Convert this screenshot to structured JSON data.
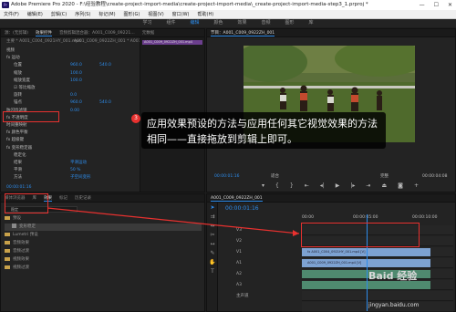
{
  "window": {
    "title": "Adobe Premiere Pro 2020 - F:\\经验教程\\create-project-import-media\\create-project-import-media\\_create-project-import-media-step3_1.prproj *",
    "controls": [
      "—",
      "☐",
      "✕"
    ]
  },
  "menu": [
    "文件(F)",
    "编辑(E)",
    "剪辑(C)",
    "序列(S)",
    "标记(M)",
    "图形(G)",
    "视图(V)",
    "窗口(W)",
    "帮助(H)"
  ],
  "workspaces": {
    "items": [
      "学习",
      "组件",
      "编辑",
      "颜色",
      "效果",
      "音频",
      "图形",
      "库"
    ],
    "active_index": 2
  },
  "effect_controls": {
    "tabs": [
      "源：(无剪辑)",
      "效果控件",
      "音频剪辑混合器：A001_C009_09221…",
      "元数据"
    ],
    "active_tab_index": 1,
    "source_label": "主要 * A001_C004_0921HY_001.mp4",
    "sequence_label": "A001_C009_0922ZH_001 * A001_C…",
    "clip_name": "A001_C009_0922ZH_001.mp4",
    "rows": [
      {
        "label": "视频",
        "value": "",
        "value2": ""
      },
      {
        "label": "fx 运动",
        "value": "",
        "value2": ""
      },
      {
        "label": "位置",
        "value": "960.0",
        "value2": "540.0"
      },
      {
        "label": "缩放",
        "value": "100.0",
        "value2": ""
      },
      {
        "label": "缩放宽度",
        "value": "100.0",
        "value2": ""
      },
      {
        "label": "☑ 等比缩放",
        "value": "",
        "value2": ""
      },
      {
        "label": "旋转",
        "value": "0.0",
        "value2": ""
      },
      {
        "label": "锚点",
        "value": "960.0",
        "value2": "540.0"
      },
      {
        "label": "防闪烁滤镜",
        "value": "0.00",
        "value2": ""
      },
      {
        "label": "fx 不透明度",
        "value": "",
        "value2": ""
      },
      {
        "label": "时间重映射",
        "value": "",
        "value2": ""
      },
      {
        "label": "fx 颜色平衡",
        "value": "",
        "value2": ""
      },
      {
        "label": "fx 超级键",
        "value": "",
        "value2": ""
      },
      {
        "label": "fx 变形稳定器",
        "value": "",
        "value2": ""
      },
      {
        "label": "稳定化",
        "value": "",
        "value2": ""
      },
      {
        "label": "结果",
        "value": "平滑运动",
        "value2": ""
      },
      {
        "label": "平滑",
        "value": "50 %",
        "value2": ""
      },
      {
        "label": "方法",
        "value": "子空间变形",
        "value2": ""
      }
    ],
    "timecode": "00:00:01:16"
  },
  "program_monitor": {
    "title": "节目：A001_C009_0922ZH_001",
    "timecode": "00:00:01:16",
    "fit": "适合",
    "quality": "完整",
    "duration": "00:00:04:08"
  },
  "project_panel": {
    "tabs": [
      "媒体浏览器",
      "库",
      "效果",
      "标记",
      "历史记录"
    ],
    "active_tab_index": 2,
    "search_value": "稳定",
    "rows": [
      {
        "label": "预设",
        "indent": 0,
        "folder": true
      },
      {
        "label": "变形稳定",
        "indent": 1,
        "folder": false,
        "highlight": true
      },
      {
        "label": "Lumetri 预设",
        "indent": 0,
        "folder": true
      },
      {
        "label": "音频效果",
        "indent": 0,
        "folder": true
      },
      {
        "label": "音频过渡",
        "indent": 0,
        "folder": true
      },
      {
        "label": "视频效果",
        "indent": 0,
        "folder": true
      },
      {
        "label": "视频过渡",
        "indent": 0,
        "folder": true
      }
    ]
  },
  "timeline": {
    "sequence_tab": "A001_C009_0922ZH_001",
    "timecode": "00:00:01:16",
    "ruler": [
      "00:00",
      "00:00:05:00",
      "00:00:10:00"
    ],
    "tracks": [
      {
        "name": "V3",
        "clip": "",
        "type": "v",
        "frac": 0
      },
      {
        "name": "V2",
        "clip": "",
        "type": "v",
        "frac": 0
      },
      {
        "name": "V1",
        "clip": "fx A001_C004_0921HY_001.mp4 [V]",
        "type": "v",
        "frac": 0.85
      },
      {
        "name": "A1",
        "clip": "A001_C009_0922ZH_001.mp4 [V]",
        "type": "v",
        "frac": 0.85
      },
      {
        "name": "A2",
        "clip": "",
        "type": "a",
        "frac": 0.85
      },
      {
        "name": "A3",
        "clip": "",
        "type": "a",
        "frac": 0.85
      },
      {
        "name": "主声道",
        "clip": "",
        "type": "m",
        "frac": 0
      },
      {
        "name": "",
        "clip": "",
        "type": "m",
        "frac": 0
      }
    ],
    "master_value": "0.0"
  },
  "callout": {
    "number": "3",
    "text": "应用效果预设的方法与应用任何其它视觉效果的方法相同——直接拖放到剪辑上即可。"
  },
  "watermark": {
    "brand": "Baid 经验",
    "url": "jingyan.baidu.com"
  },
  "colors": {
    "accent": "#2d8ceb",
    "highlight": "#e8312f",
    "clip_video": "#7da2d2",
    "clip_audio": "#4f8a6f"
  }
}
